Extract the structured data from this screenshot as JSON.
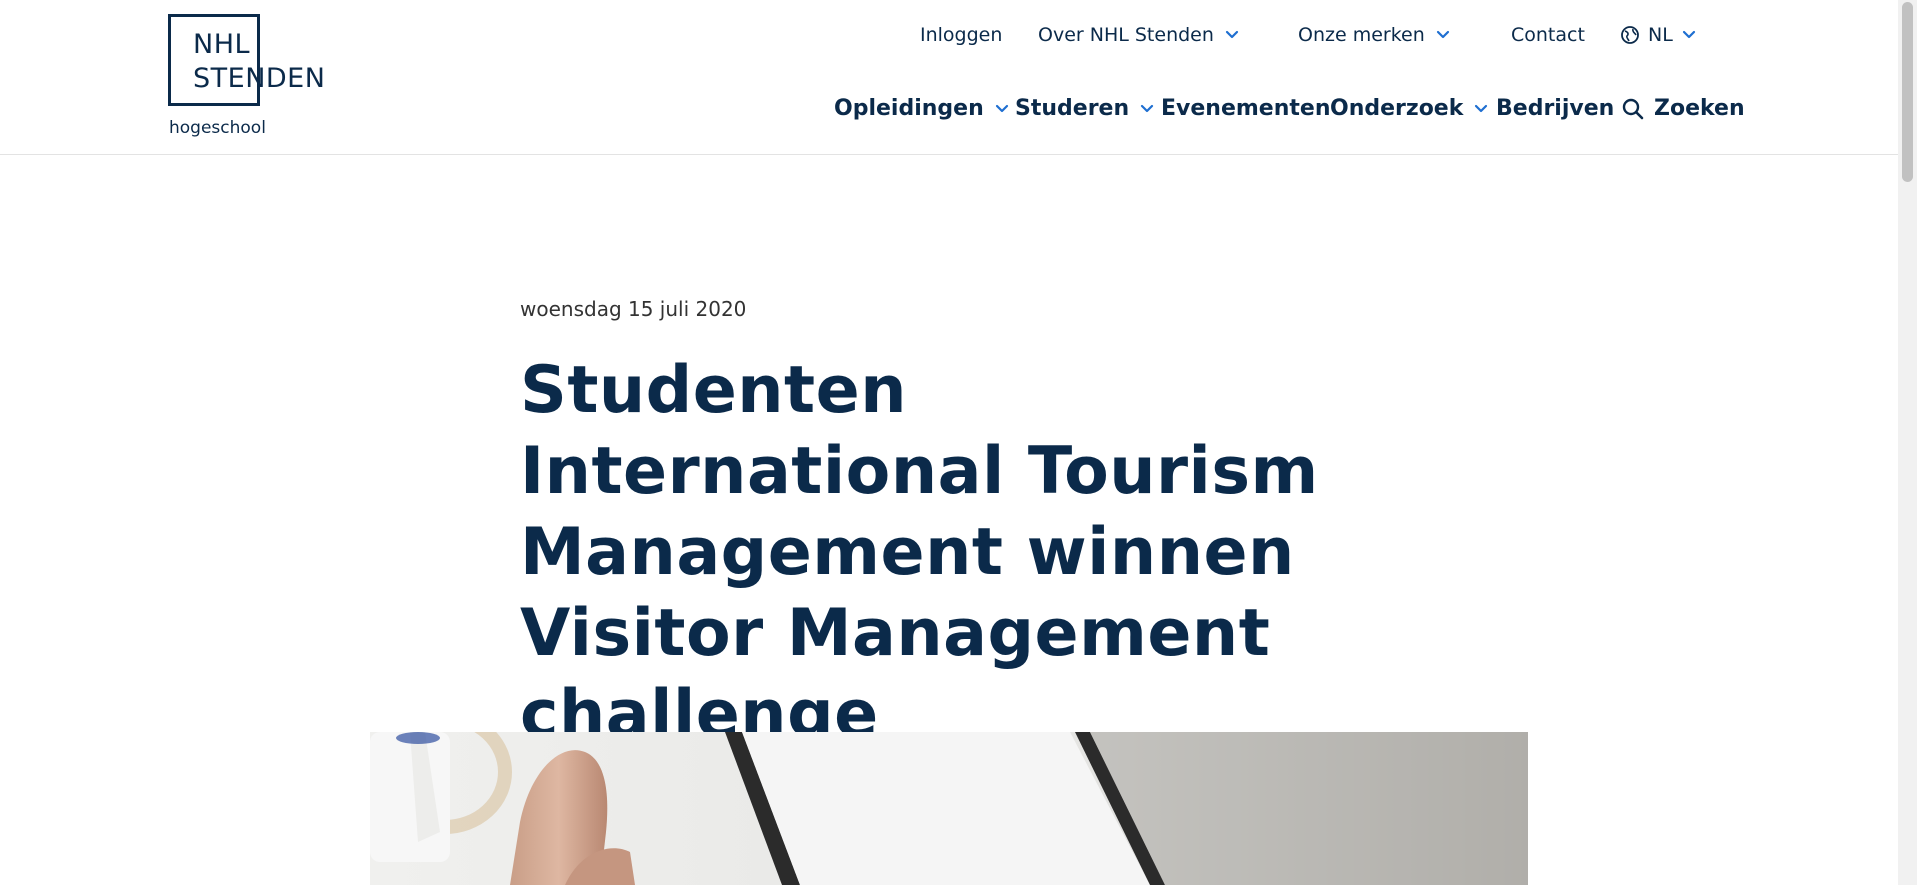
{
  "logo": {
    "line1": "NHL",
    "line2": "STENDEN",
    "sub": "hogeschool"
  },
  "top_nav": {
    "login": "Inloggen",
    "about": "Over NHL Stenden",
    "brands": "Onze merken",
    "contact": "Contact",
    "language": "NL"
  },
  "main_nav": {
    "programs": "Opleidingen",
    "studying": "Studeren",
    "events": "Evenementen",
    "research": "Onderzoek",
    "companies": "Bedrijven",
    "search": "Zoeken"
  },
  "article": {
    "date": "woensdag 15 juli 2020",
    "title": "Studenten International Tourism Management winnen Visitor Management challenge"
  },
  "colors": {
    "brand": "#0b2a4a",
    "accent": "#1f6fd1"
  }
}
